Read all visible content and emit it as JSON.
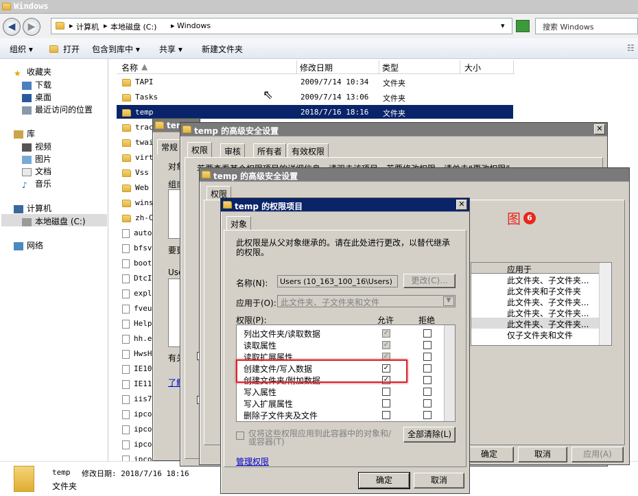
{
  "explorer": {
    "title": "Windows",
    "breadcrumb": [
      "计算机",
      "本地磁盘 (C:)",
      "Windows"
    ],
    "search_placeholder": "搜索 Windows",
    "toolbar": {
      "organize": "组织 ▾",
      "open": "打开",
      "include": "包含到库中 ▾",
      "share": "共享 ▾",
      "new_folder": "新建文件夹"
    },
    "nav": {
      "favorites": "收藏夹",
      "downloads": "下载",
      "desktop": "桌面",
      "recent": "最近访问的位置",
      "library": "库",
      "videos": "视频",
      "pictures": "图片",
      "documents": "文档",
      "music": "音乐",
      "computer": "计算机",
      "local_disk": "本地磁盘 (C:)",
      "network": "网络"
    },
    "columns": {
      "name": "名称",
      "date": "修改日期",
      "type": "类型",
      "size": "大小"
    },
    "files": [
      {
        "name": "TAPI",
        "date": "2009/7/14 10:34",
        "type": "文件夹"
      },
      {
        "name": "Tasks",
        "date": "2009/7/14 13:06",
        "type": "文件夹"
      },
      {
        "name": "temp",
        "date": "2018/7/16 18:16",
        "type": "文件夹"
      }
    ],
    "partial_files": [
      "trac",
      "twai",
      "virt",
      "Vss",
      "Web",
      "wins",
      "zh-C",
      "auto",
      "bfsv",
      "boot",
      "DtcI",
      "expl",
      "fveu",
      "Help",
      "hh.e",
      "HwsH",
      "IE10",
      "IE11",
      "iis7",
      "ipco",
      "ipconfig_devconf",
      "ipconfig_post.ba",
      "ipconfig_post.lo"
    ],
    "status": {
      "name": "temp",
      "date_label": "修改日期: 2018/7/16 18:16",
      "type": "文件夹"
    }
  },
  "props_window": {
    "title": "temp",
    "tab_general": "常规",
    "label_obj": "对象",
    "label_group": "组或",
    "label_need": "要更",
    "label_users": "Use",
    "label_has": "有关",
    "link": "了解"
  },
  "adv1": {
    "title": "temp 的高级安全设置",
    "tabs": [
      "权限",
      "审核",
      "所有者",
      "有效权限"
    ],
    "desc": "若要查看某个权限项目的详细信息，请双击该项目。若要修改权限，请单击“更改权限”。"
  },
  "adv2": {
    "title": "temp 的高级安全设置",
    "tab": "权限",
    "annotation": "图",
    "annotation_num": "6",
    "list_header": "应用于",
    "applies": [
      "此文件夹、子文件夹...",
      "此文件夹和子文件夹",
      "此文件夹、子文件夹...",
      "此文件夹、子文件夹...",
      "此文件夹、子文件夹...",
      "仅子文件夹和文件"
    ],
    "ok": "确定",
    "cancel": "取消",
    "apply": "应用(A)"
  },
  "entry": {
    "title": "temp 的权限项目",
    "tab": "对象",
    "inherited_note": "此权限是从父对象继承的。请在此处进行更改，以替代继承的权限。",
    "name_label": "名称(N):",
    "name_value": "Users (10_163_100_16\\Users)",
    "change_btn": "更改(C)...",
    "apply_label": "应用于(O):",
    "apply_value": "此文件夹、子文件夹和文件",
    "perm_label": "权限(P):",
    "allow": "允许",
    "deny": "拒绝",
    "permissions": [
      {
        "name": "列出文件夹/读取数据",
        "allow": true,
        "allow_gray": true
      },
      {
        "name": "读取属性",
        "allow": true,
        "allow_gray": true
      },
      {
        "name": "读取扩展属性",
        "allow": true,
        "allow_gray": true
      },
      {
        "name": "创建文件/写入数据",
        "allow": true,
        "allow_gray": false
      },
      {
        "name": "创建文件夹/附加数据",
        "allow": true,
        "allow_gray": false
      },
      {
        "name": "写入属性",
        "allow": false,
        "allow_gray": false
      },
      {
        "name": "写入扩展属性",
        "allow": false,
        "allow_gray": false
      },
      {
        "name": "删除子文件夹及文件",
        "allow": false,
        "allow_gray": false
      }
    ],
    "only_apply": "仅将这些权限应用到此容器中的对象和/或容器(T)",
    "clear_all": "全部清除(L)",
    "manage": "管理权限",
    "ok": "确定",
    "cancel": "取消"
  },
  "colors": {
    "highlight": "#0a246a",
    "annotation_red": "#e8271e"
  }
}
